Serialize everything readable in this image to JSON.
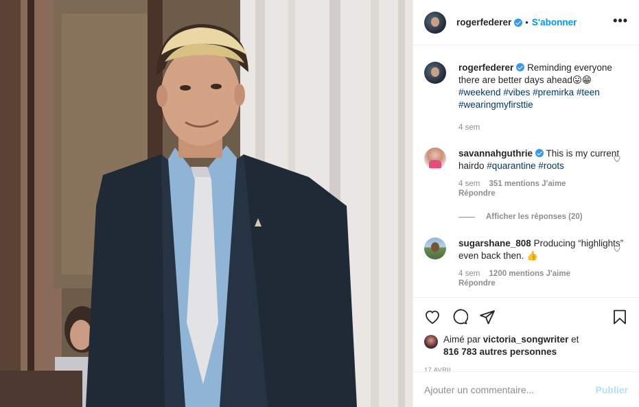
{
  "post": {
    "author": "rogerfederer",
    "follow_label": "S'abonner",
    "dot": "•",
    "more_label": "•••"
  },
  "caption": {
    "username": "rogerfederer",
    "text": "Reminding everyone there are better days ahead😛😁",
    "hashtags": [
      "#weekend",
      "#vibes",
      "#premirka",
      "#teen",
      "#wearingmyfirsttie"
    ],
    "time": "4 sem"
  },
  "comments": [
    {
      "username": "savannahguthrie",
      "verified": true,
      "text": "This is my current hairdo",
      "hashtags": [
        "#quarantine",
        "#roots"
      ],
      "time": "4 sem",
      "likes": "351 mentions J'aime",
      "reply_label": "Répondre",
      "view_replies": "Afficher les réponses (20)"
    },
    {
      "username": "sugarshane_808",
      "verified": false,
      "text": "Producing “highlights” even back then. 👍",
      "time": "4 sem",
      "likes": "1200 mentions J'aime",
      "reply_label": "Répondre"
    }
  ],
  "liked_by": {
    "prefix": "Aimé par",
    "user": "victoria_songwriter",
    "connector": "et",
    "others": "816 783 autres personnes"
  },
  "date": "17 AVRIL",
  "add_comment": {
    "placeholder": "Ajouter un commentaire...",
    "publish_label": "Publier"
  },
  "icons": {
    "like": "heart-icon",
    "comment": "comment-icon",
    "share": "paper-plane-icon",
    "save": "bookmark-icon",
    "verified": "verified-badge-icon"
  },
  "colors": {
    "accent": "#0095f6",
    "hashtag": "#00376b",
    "muted": "#8e8e8e",
    "verified": "#3897f0",
    "publish_disabled": "#b2dffc"
  }
}
